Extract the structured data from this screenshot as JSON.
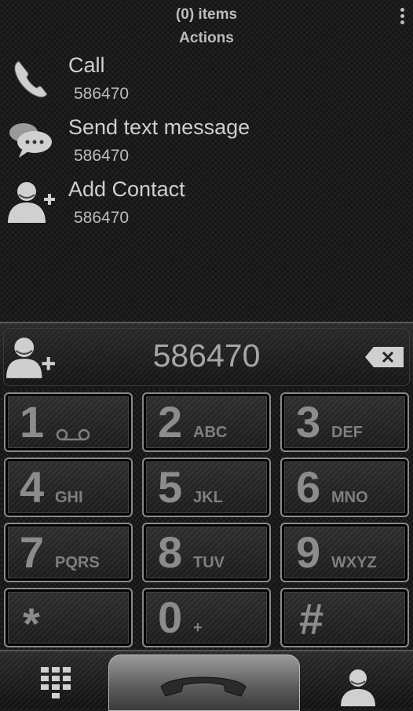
{
  "header": {
    "count": "(0) items",
    "title": "Actions"
  },
  "actions": [
    {
      "label": "Call",
      "number": "586470",
      "icon": "phone-icon"
    },
    {
      "label": "Send text message",
      "number": "586470",
      "icon": "chat-bubbles-icon"
    },
    {
      "label": "Add Contact",
      "number": "586470",
      "icon": "add-contact-icon"
    }
  ],
  "dialer": {
    "entered_number": "586470"
  },
  "keys": [
    {
      "digit": "1",
      "letters": ""
    },
    {
      "digit": "2",
      "letters": "ABC"
    },
    {
      "digit": "3",
      "letters": "DEF"
    },
    {
      "digit": "4",
      "letters": "GHI"
    },
    {
      "digit": "5",
      "letters": "JKL"
    },
    {
      "digit": "6",
      "letters": "MNO"
    },
    {
      "digit": "7",
      "letters": "PQRS"
    },
    {
      "digit": "8",
      "letters": "TUV"
    },
    {
      "digit": "9",
      "letters": "WXYZ"
    },
    {
      "digit": "*",
      "letters": ""
    },
    {
      "digit": "0",
      "letters": "+"
    },
    {
      "digit": "#",
      "letters": ""
    }
  ],
  "colors": {
    "background": "#1a1a1a",
    "text": "#c8c8c8",
    "key_digit": "#8c8c8c"
  }
}
